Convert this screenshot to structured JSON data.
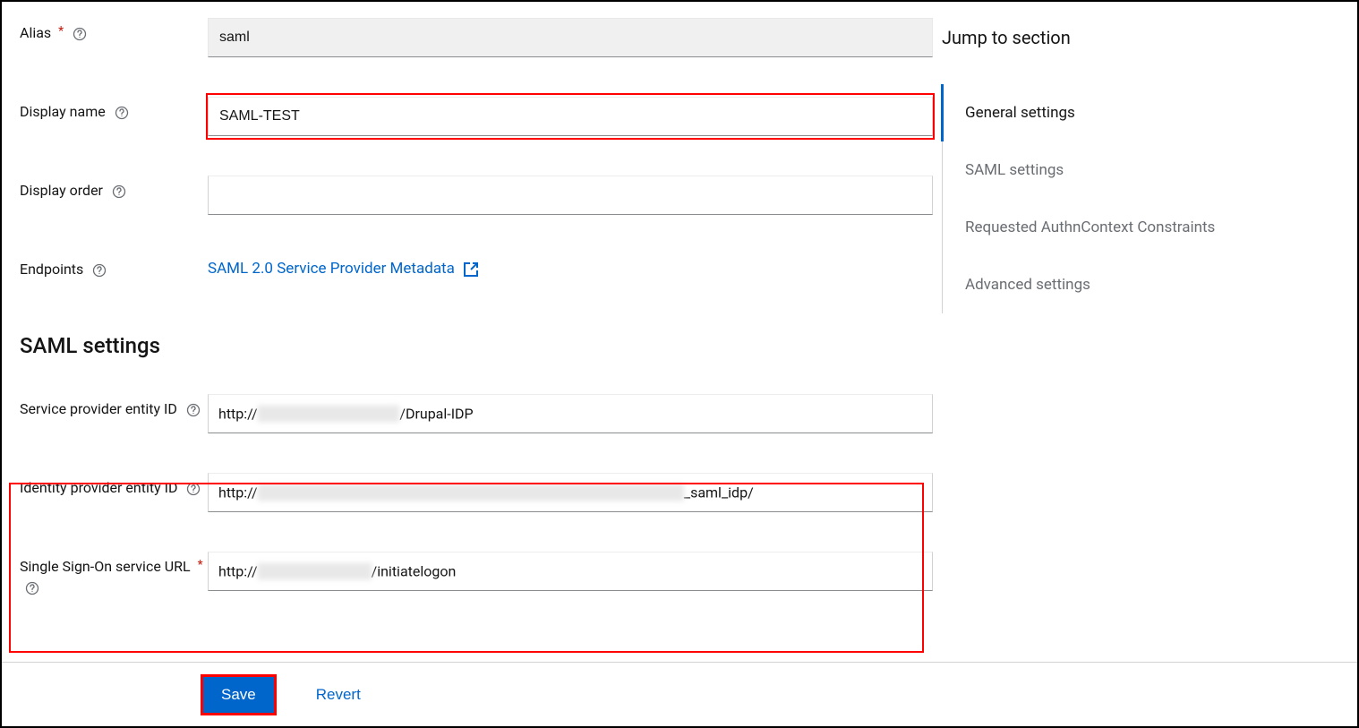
{
  "fields": {
    "alias": {
      "label": "Alias",
      "value": "saml"
    },
    "display_name": {
      "label": "Display name",
      "value": "SAML-TEST"
    },
    "display_order": {
      "label": "Display order",
      "value": ""
    },
    "endpoints": {
      "label": "Endpoints",
      "link_text": "SAML 2.0 Service Provider Metadata"
    },
    "sp_entity_id": {
      "label": "Service provider entity ID",
      "prefix": "http://",
      "redacted": "xxxxxxxxxxxxxxxxxxxx",
      "suffix": "/Drupal-IDP"
    },
    "idp_entity_id": {
      "label": "Identity provider entity ID",
      "prefix": "http://",
      "redacted": "xxxxxxxxxxxxxxxxxxxxxxxxxxxxxxxxxxxxxxxxxxxxxxxxxxxxxxxxxxxx",
      "suffix": "_saml_idp/"
    },
    "sso_url": {
      "label": "Single Sign-On service URL",
      "prefix": "http://",
      "redacted": "xxxxxxxxxxxxxxxx",
      "suffix": "/initiatelogon"
    }
  },
  "sections": {
    "saml_heading": "SAML settings"
  },
  "nav": {
    "title": "Jump to section",
    "items": [
      {
        "label": "General settings",
        "active": true
      },
      {
        "label": "SAML settings",
        "active": false
      },
      {
        "label": "Requested AuthnContext Constraints",
        "active": false
      },
      {
        "label": "Advanced settings",
        "active": false
      }
    ]
  },
  "footer": {
    "save": "Save",
    "revert": "Revert"
  }
}
